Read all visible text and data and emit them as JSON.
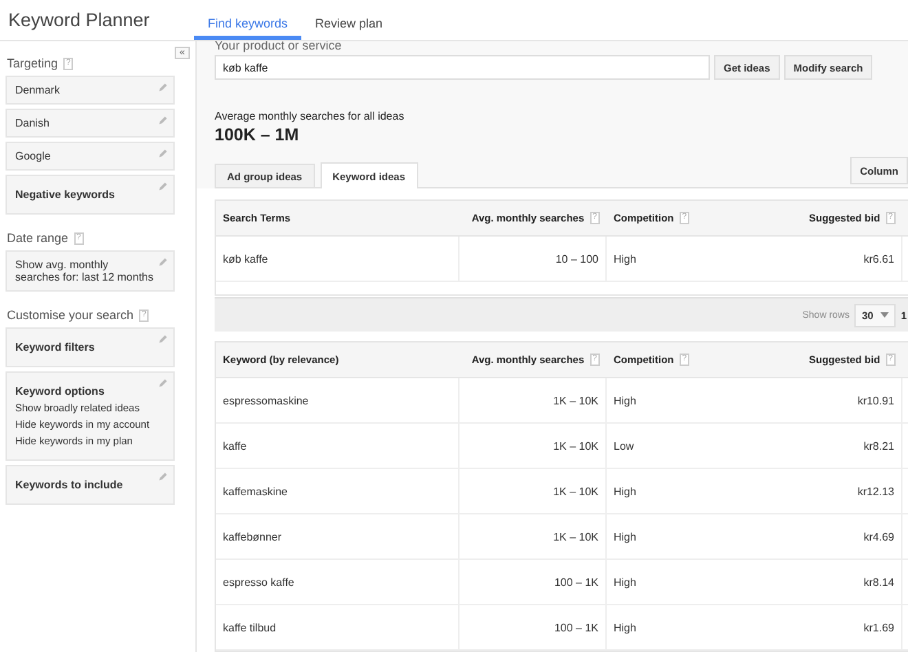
{
  "app_title": "Keyword Planner",
  "nav_tabs": [
    {
      "label": "Find keywords",
      "selected": true
    },
    {
      "label": "Review plan",
      "selected": false
    }
  ],
  "collapse_button": "«",
  "sidebar": {
    "sections": [
      {
        "title": "Targeting",
        "help": "?",
        "cards": [
          {
            "kind": "value",
            "text": "Denmark"
          },
          {
            "kind": "value",
            "text": "Danish"
          },
          {
            "kind": "value",
            "text": "Google"
          },
          {
            "kind": "setting",
            "title": "Negative keywords"
          }
        ]
      },
      {
        "title": "Date range",
        "help": "?",
        "cards": [
          {
            "kind": "value",
            "text": "Show avg. monthly searches for: last 12 months"
          }
        ]
      },
      {
        "title": "Customise your search",
        "help": "?",
        "cards": [
          {
            "kind": "setting",
            "title": "Keyword filters"
          },
          {
            "kind": "setting",
            "title": "Keyword options",
            "lines": [
              "Show broadly related ideas",
              "Hide keywords in my account",
              "Hide keywords in my plan"
            ]
          },
          {
            "kind": "setting",
            "title": "Keywords to include"
          }
        ]
      }
    ]
  },
  "product_field": {
    "label": "Your product or service",
    "value": "køb kaffe"
  },
  "buttons": [
    "Get ideas",
    "Modify search"
  ],
  "summary": {
    "label": "Average monthly searches for all ideas",
    "value": "100K – 1M"
  },
  "result_tabs": [
    {
      "label": "Ad group ideas",
      "selected": false
    },
    {
      "label": "Keyword ideas",
      "selected": true
    }
  ],
  "columns_button": "Column",
  "search_terms_table": {
    "columns": [
      {
        "label": "Search Terms"
      },
      {
        "label": "Avg. monthly searches",
        "help": "?"
      },
      {
        "label": "Competition",
        "help": "?"
      },
      {
        "label": "Suggested bid",
        "help": "?"
      }
    ],
    "rows": [
      [
        "køb kaffe",
        "10 – 100",
        "High",
        "kr6.61"
      ]
    ]
  },
  "pager": {
    "label": "Show rows",
    "rows_value": "30",
    "page": "1"
  },
  "keyword_table": {
    "columns": [
      {
        "label": "Keyword (by relevance)"
      },
      {
        "label": "Avg. monthly searches",
        "help": "?"
      },
      {
        "label": "Competition",
        "help": "?"
      },
      {
        "label": "Suggested bid",
        "help": "?"
      }
    ],
    "rows": [
      [
        "espressomaskine",
        "1K – 10K",
        "High",
        "kr10.91"
      ],
      [
        "kaffe",
        "1K – 10K",
        "Low",
        "kr8.21"
      ],
      [
        "kaffemaskine",
        "1K – 10K",
        "High",
        "kr12.13"
      ],
      [
        "kaffebønner",
        "1K – 10K",
        "High",
        "kr4.69"
      ],
      [
        "espresso kaffe",
        "100 – 1K",
        "High",
        "kr8.14"
      ],
      [
        "kaffe tilbud",
        "100 – 1K",
        "High",
        "kr1.69"
      ]
    ]
  }
}
